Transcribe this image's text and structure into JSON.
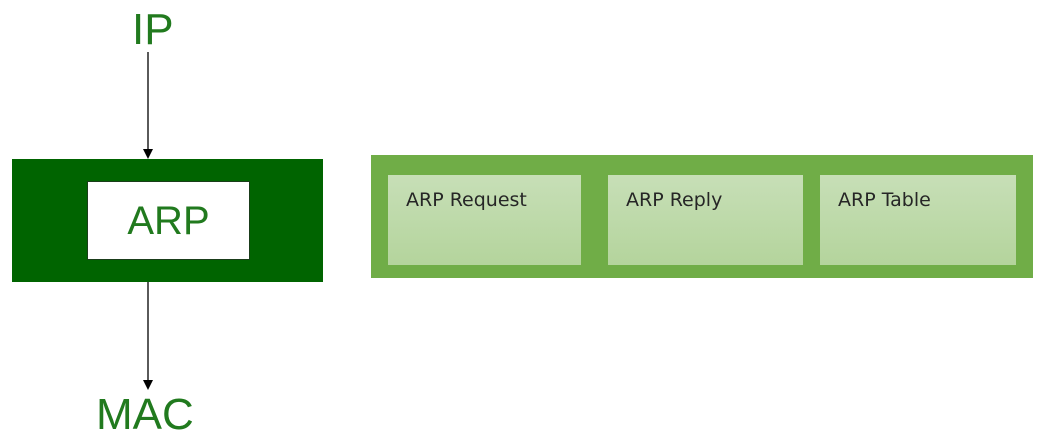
{
  "diagram": {
    "input_label": "IP",
    "output_label": "MAC",
    "protocol_label": "ARP",
    "components": [
      {
        "label": "ARP Request"
      },
      {
        "label": "ARP Reply"
      },
      {
        "label": "ARP Table"
      }
    ],
    "colors": {
      "label_green": "#217a1e",
      "protocol_block": "#006400",
      "component_panel": "#70ad47",
      "component_box": "#c7dfb7",
      "arrow": "#000000"
    }
  }
}
